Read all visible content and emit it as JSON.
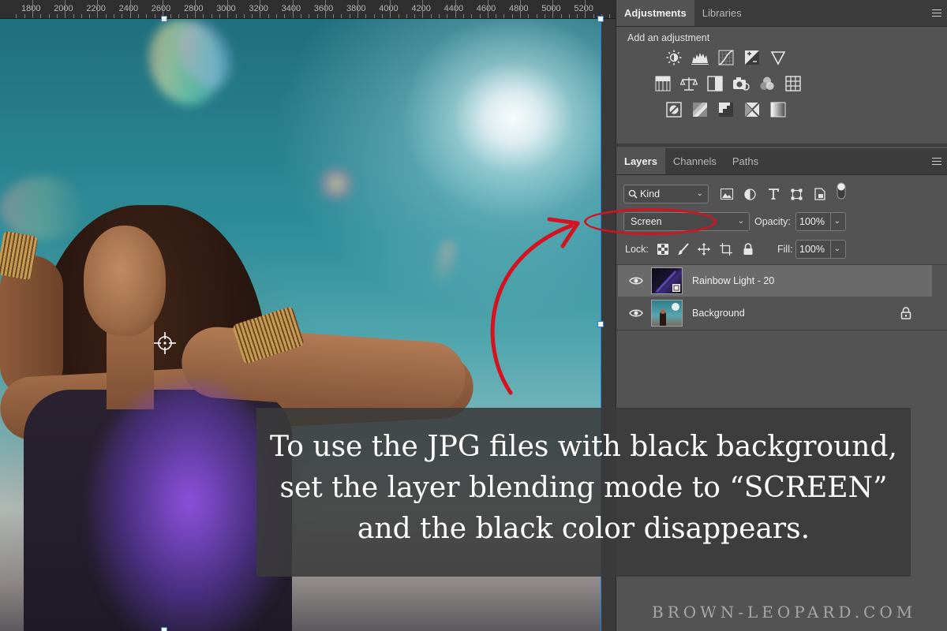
{
  "ruler": {
    "labels": [
      "1800",
      "2000",
      "2200",
      "2400",
      "2600",
      "2800",
      "3000",
      "3200",
      "3400",
      "3600",
      "3800",
      "4000",
      "4200",
      "4400",
      "4600",
      "4800",
      "5000",
      "5200"
    ]
  },
  "adjustments_panel": {
    "tabs": [
      "Adjustments",
      "Libraries"
    ],
    "active_tab": "Adjustments",
    "heading": "Add an adjustment",
    "icons_row1": [
      "brightness-contrast-icon",
      "levels-icon",
      "curves-icon",
      "exposure-icon",
      "vibrance-icon"
    ],
    "icons_row2": [
      "hue-saturation-icon",
      "color-balance-icon",
      "black-white-icon",
      "photo-filter-icon",
      "channel-mixer-icon",
      "color-lookup-icon"
    ],
    "icons_row3": [
      "invert-icon",
      "posterize-icon",
      "threshold-icon",
      "selective-color-icon",
      "gradient-map-icon"
    ]
  },
  "layers_panel": {
    "tabs": [
      "Layers",
      "Channels",
      "Paths"
    ],
    "active_tab": "Layers",
    "filter_kind": "Kind",
    "blend_mode": "Screen",
    "opacity_label": "Opacity:",
    "opacity_value": "100%",
    "lock_label": "Lock:",
    "fill_label": "Fill:",
    "fill_value": "100%",
    "layers": [
      {
        "name": "Rainbow Light - 20",
        "selected": true,
        "locked": false
      },
      {
        "name": "Background",
        "selected": false,
        "locked": true
      }
    ]
  },
  "caption": {
    "line1": "To use the JPG files with black background,",
    "line2": "set the layer blending mode to “SCREEN”",
    "line3": "and the black color disappears."
  },
  "watermark": "BROWN-LEOPARD.COM",
  "colors": {
    "annotation_red": "#d51320",
    "panel_bg": "#535353",
    "tab_bar_bg": "#3c3c3c",
    "selection_blue": "#2d7bd5"
  }
}
